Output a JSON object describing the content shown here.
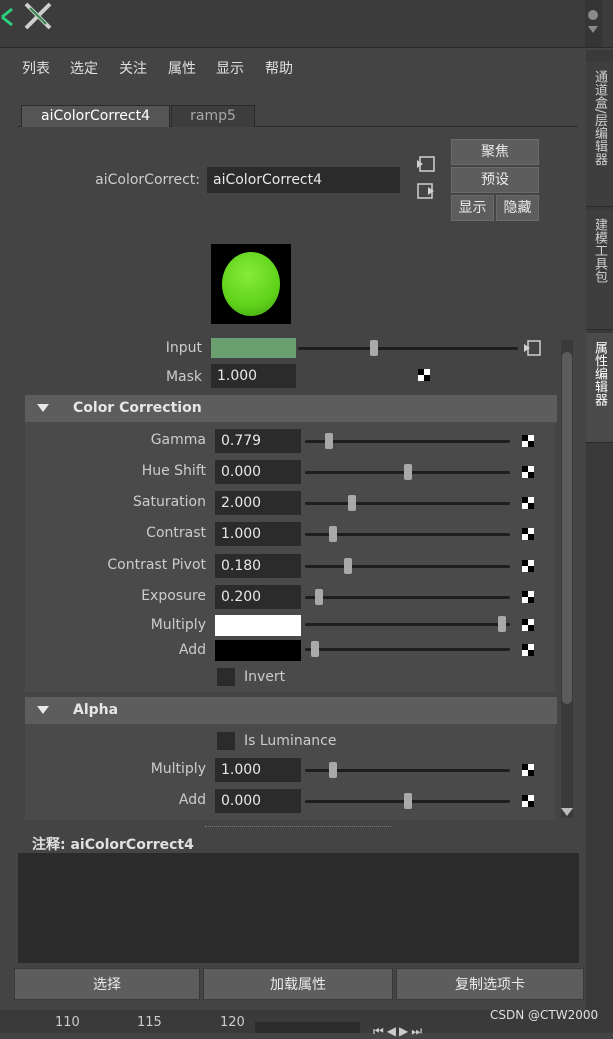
{
  "menu": [
    "列表",
    "选定",
    "关注",
    "属性",
    "显示",
    "帮助"
  ],
  "side_tabs": [
    "通道盒/层编辑器",
    "建模工具包",
    "属性编辑器"
  ],
  "tabs": [
    "aiColorCorrect4",
    "ramp5"
  ],
  "node": {
    "label": "aiColorCorrect:",
    "value": "aiColorCorrect4"
  },
  "buttons": {
    "focus": "聚焦",
    "presets": "预设",
    "show": "显示",
    "hide": "隐藏"
  },
  "swatch_color": "#5fd21a",
  "input": {
    "label": "Input",
    "color": "#6aa070"
  },
  "mask": {
    "label": "Mask",
    "value": "1.000"
  },
  "color_correction": {
    "title": "Color Correction",
    "rows": [
      {
        "label": "Gamma",
        "value": "0.779",
        "pos": 0.1
      },
      {
        "label": "Hue Shift",
        "value": "0.000",
        "pos": 0.5
      },
      {
        "label": "Saturation",
        "value": "2.000",
        "pos": 0.22
      },
      {
        "label": "Contrast",
        "value": "1.000",
        "pos": 0.12
      },
      {
        "label": "Contrast Pivot",
        "value": "0.180",
        "pos": 0.2
      },
      {
        "label": "Exposure",
        "value": "0.200",
        "pos": 0.05
      }
    ],
    "multiply": {
      "label": "Multiply",
      "color": "#ffffff",
      "pos": 0.98
    },
    "add": {
      "label": "Add",
      "color": "#000000",
      "pos": 0.03
    },
    "invert": "Invert"
  },
  "alpha": {
    "title": "Alpha",
    "is_luminance": "Is Luminance",
    "rows": [
      {
        "label": "Multiply",
        "value": "1.000",
        "pos": 0.12
      },
      {
        "label": "Add",
        "value": "0.000",
        "pos": 0.5
      }
    ]
  },
  "notes_label": "注释:  aiColorCorrect4",
  "bottom_buttons": [
    "选择",
    "加载属性",
    "复制选项卡"
  ],
  "timeline_ticks": [
    "110",
    "115",
    "120"
  ],
  "watermark": "CSDN @CTW2000"
}
